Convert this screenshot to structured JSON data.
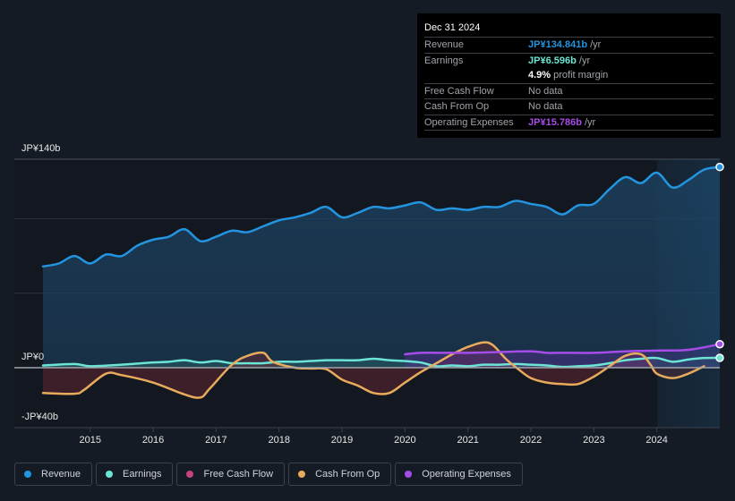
{
  "tooltip": {
    "date": "Dec 31 2024",
    "rows": [
      {
        "label": "Revenue",
        "value": "JP¥134.841b",
        "suffix": " /yr",
        "color": "#2394df"
      },
      {
        "label": "Earnings",
        "value": "JP¥6.596b",
        "suffix": " /yr",
        "color": "#6ce5d4"
      },
      {
        "label": "",
        "value": "4.9%",
        "suffix": " profit margin",
        "color": "#ffffff"
      },
      {
        "label": "Free Cash Flow",
        "value": "",
        "suffix": "No data",
        "color": "#a0a4aa"
      },
      {
        "label": "Cash From Op",
        "value": "",
        "suffix": "No data",
        "color": "#a0a4aa"
      },
      {
        "label": "Operating Expenses",
        "value": "JP¥15.786b",
        "suffix": " /yr",
        "color": "#a54de8"
      }
    ]
  },
  "legend": [
    {
      "label": "Revenue",
      "color": "#2394df"
    },
    {
      "label": "Earnings",
      "color": "#6ce5d4"
    },
    {
      "label": "Free Cash Flow",
      "color": "#c4427e"
    },
    {
      "label": "Cash From Op",
      "color": "#e8ab5c"
    },
    {
      "label": "Operating Expenses",
      "color": "#a54de8"
    }
  ],
  "chart_data": {
    "type": "area",
    "title": "",
    "xlabel": "",
    "ylabel": "",
    "y_axis_labels": [
      "JP¥140b",
      "JP¥0",
      "-JP¥40b"
    ],
    "ylim": [
      -40,
      140
    ],
    "xlim": [
      2014.25,
      2025.0
    ],
    "x_ticks": [
      "2015",
      "2016",
      "2017",
      "2018",
      "2019",
      "2020",
      "2021",
      "2022",
      "2023",
      "2024"
    ],
    "gridlines": [
      140,
      100,
      50,
      0
    ],
    "highlight_region_start": 2024.0,
    "legend_position": "bottom-left",
    "series": [
      {
        "name": "Revenue",
        "color": "#2394df",
        "x": [
          2014.25,
          2014.5,
          2014.75,
          2015.0,
          2015.25,
          2015.5,
          2015.75,
          2016.0,
          2016.25,
          2016.5,
          2016.75,
          2017.0,
          2017.25,
          2017.5,
          2017.75,
          2018.0,
          2018.25,
          2018.5,
          2018.75,
          2019.0,
          2019.25,
          2019.5,
          2019.75,
          2020.0,
          2020.25,
          2020.5,
          2020.75,
          2021.0,
          2021.25,
          2021.5,
          2021.75,
          2022.0,
          2022.25,
          2022.5,
          2022.75,
          2023.0,
          2023.25,
          2023.5,
          2023.75,
          2024.0,
          2024.25,
          2024.5,
          2024.75,
          2025.0
        ],
        "values": [
          68,
          70,
          75,
          70,
          76,
          75,
          82,
          86,
          88,
          93,
          85,
          88,
          92,
          91,
          95,
          99,
          101,
          104,
          108,
          101,
          104,
          108,
          107,
          109,
          111,
          106,
          107,
          106,
          108,
          108,
          112,
          110,
          108,
          103,
          109,
          110,
          120,
          128,
          124,
          131,
          121,
          126,
          133,
          134.8
        ]
      },
      {
        "name": "Earnings",
        "color": "#6ce5d4",
        "x": [
          2014.25,
          2014.75,
          2015.0,
          2015.5,
          2016.0,
          2016.25,
          2016.5,
          2016.75,
          2017.0,
          2017.25,
          2017.5,
          2017.75,
          2018.0,
          2018.25,
          2018.5,
          2018.75,
          2019.0,
          2019.25,
          2019.5,
          2019.75,
          2020.0,
          2020.25,
          2020.5,
          2020.75,
          2021.0,
          2021.25,
          2021.5,
          2021.75,
          2022.0,
          2022.25,
          2022.5,
          2022.75,
          2023.0,
          2023.25,
          2023.5,
          2023.75,
          2024.0,
          2024.25,
          2024.5,
          2024.75,
          2025.0
        ],
        "values": [
          1.5,
          2.5,
          1,
          2,
          3.5,
          4,
          5,
          3.5,
          4.5,
          3,
          3,
          3,
          4,
          4,
          4.5,
          5,
          5,
          5,
          6,
          5,
          4.5,
          3.5,
          1,
          1.5,
          1,
          2,
          2,
          2.5,
          2,
          1.5,
          0.5,
          1,
          1.5,
          3,
          5,
          6,
          6.5,
          4,
          5.5,
          6.5,
          6.6
        ]
      },
      {
        "name": "Cash From Op",
        "color": "#e8ab5c",
        "x": [
          2014.25,
          2014.75,
          2014.9,
          2015.25,
          2015.5,
          2016.0,
          2016.5,
          2016.75,
          2016.9,
          2017.25,
          2017.5,
          2017.75,
          2017.9,
          2018.25,
          2018.5,
          2018.75,
          2019.0,
          2019.25,
          2019.5,
          2019.75,
          2020.0,
          2020.25,
          2020.5,
          2020.75,
          2021.0,
          2021.25,
          2021.4,
          2021.6,
          2021.8,
          2022.0,
          2022.25,
          2022.5,
          2022.75,
          2023.0,
          2023.25,
          2023.5,
          2023.75,
          2023.9,
          2024.0,
          2024.25,
          2024.5,
          2024.75
        ],
        "values": [
          -17,
          -17.5,
          -15,
          -4,
          -5,
          -10,
          -18,
          -20,
          -14,
          2,
          8,
          10,
          4,
          0,
          -0.5,
          -1,
          -8,
          -12,
          -17,
          -17,
          -10,
          -3,
          3,
          9,
          14,
          17,
          15,
          6,
          -1,
          -7,
          -10,
          -11,
          -11,
          -6,
          1,
          8,
          9,
          2,
          -4,
          -7,
          -4,
          1
        ]
      },
      {
        "name": "Operating Expenses",
        "color": "#a54de8",
        "x": [
          2020.0,
          2020.25,
          2020.5,
          2020.75,
          2021.0,
          2021.5,
          2022.0,
          2022.25,
          2022.5,
          2023.0,
          2023.5,
          2024.0,
          2024.5,
          2025.0
        ],
        "values": [
          9,
          10,
          10,
          10,
          10,
          10.5,
          11,
          10,
          10,
          10,
          11,
          11.5,
          12,
          15.8
        ]
      },
      {
        "name": "Free Cash Flow",
        "color": "#c4427e",
        "x": [],
        "values": []
      }
    ]
  }
}
